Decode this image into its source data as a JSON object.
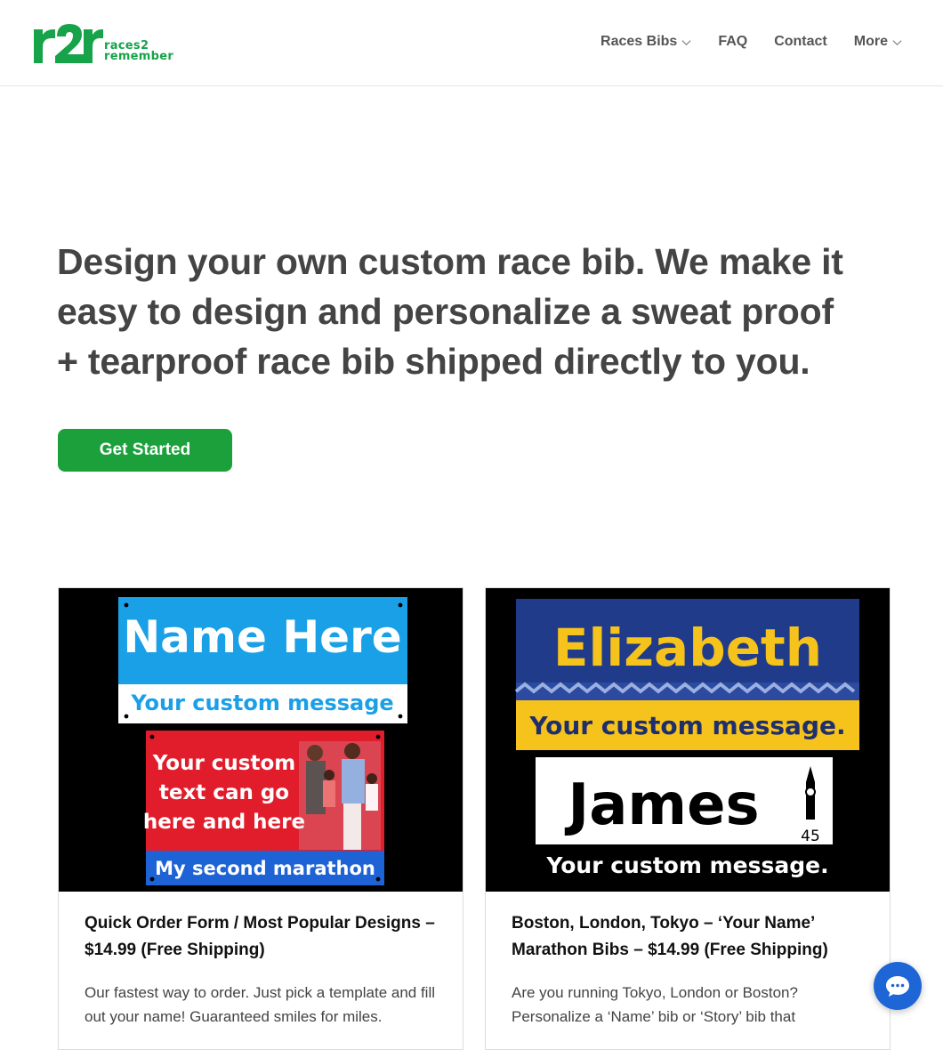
{
  "header": {
    "logo_mark": "r2r",
    "logo_line1": "races2",
    "logo_line2": "remember",
    "nav": [
      {
        "label": "Races Bibs",
        "has_dropdown": true
      },
      {
        "label": "FAQ",
        "has_dropdown": false
      },
      {
        "label": "Contact",
        "has_dropdown": false
      },
      {
        "label": "More",
        "has_dropdown": true
      }
    ]
  },
  "hero": {
    "title": "Design your own custom race bib. We make it easy to design and personalize a sweat proof + tearproof race bib shipped directly to you.",
    "cta": "Get Started"
  },
  "cards": [
    {
      "title": "Quick Order Form / Most Popular Designs – $14.99 (Free Shipping)",
      "desc": "Our fastest way to order. Just pick a template and fill out your name! Guaranteed smiles for miles.",
      "bib_top_name": "Name Here",
      "bib_top_msg": "Your custom message",
      "bib_bottom_text": [
        "Your custom",
        "text can go",
        "here and here"
      ],
      "bib_bottom_msg": "My second marathon"
    },
    {
      "title": "Boston, London, Tokyo – ‘Your Name’ Marathon Bibs – $14.99 (Free Shipping)",
      "desc": "Are you running Tokyo, London or Boston? Personalize a ‘Name’ bib or ‘Story’ bib that",
      "bib_top_name": "Elizabeth",
      "bib_top_msg": "Your custom message.",
      "bib_bottom_name": "James",
      "bib_bottom_num": "45",
      "bib_bottom_msg": "Your custom message."
    }
  ],
  "colors": {
    "brand_green": "#1ca03c",
    "logo_green": "#17a34a",
    "chat_blue": "#1e66d6"
  },
  "icons": [
    "chevron-down-icon",
    "chat-bubble-icon"
  ]
}
